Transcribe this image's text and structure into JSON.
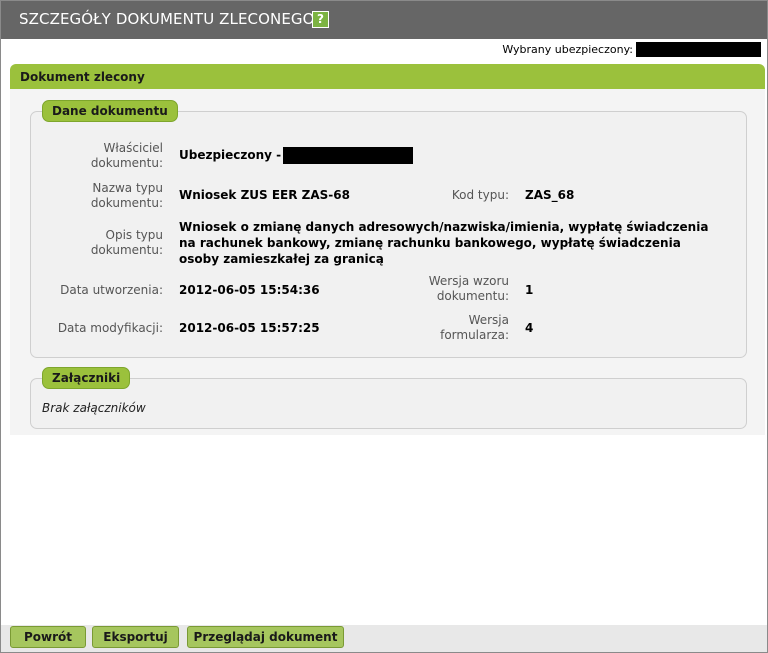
{
  "window": {
    "title": "SZCZEGÓŁY DOKUMENTU ZLECONEGO",
    "help_icon": "?"
  },
  "user": {
    "label": "Wybrany ubezpieczony:"
  },
  "section": {
    "title": "Dokument zlecony"
  },
  "details": {
    "legend": "Dane dokumentu",
    "owner": {
      "label": "Właściciel dokumentu:",
      "value": "Ubezpieczony -"
    },
    "type_name": {
      "label": "Nazwa typu dokumentu:",
      "value": "Wniosek ZUS EER ZAS-68"
    },
    "type_code": {
      "label": "Kod typu:",
      "value": "ZAS_68"
    },
    "description": {
      "label": "Opis typu dokumentu:",
      "value": "Wniosek o zmianę danych adresowych/nazwiska/imienia, wypłatę świadczenia na rachunek bankowy, zmianę rachunku bankowego, wypłatę świadczenia osoby zamieszkałej za granicą"
    },
    "created": {
      "label": "Data utworzenia:",
      "value": "2012-06-05 15:54:36"
    },
    "template_version": {
      "label": "Wersja wzoru dokumentu:",
      "value": "1"
    },
    "modified": {
      "label": "Data modyfikacji:",
      "value": "2012-06-05 15:57:25"
    },
    "form_version": {
      "label": "Wersja formularza:",
      "value": "4"
    }
  },
  "attachments": {
    "legend": "Załączniki",
    "empty_text": "Brak załączników"
  },
  "buttons": {
    "back": "Powrót",
    "export": "Eksportuj",
    "view": "Przeglądaj dokument"
  }
}
